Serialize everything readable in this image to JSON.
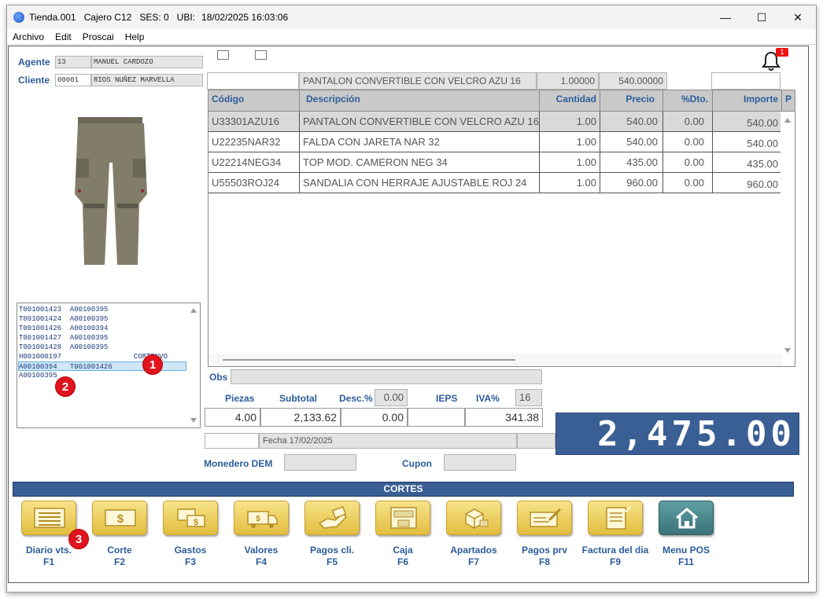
{
  "window": {
    "title_store": "Tienda.001",
    "title_cashier": "Cajero C12",
    "title_ses": "SES: 0",
    "title_ubi": "UBI:",
    "title_datetime": "18/02/2025 16:03:06",
    "minimize": "—",
    "maximize": "☐",
    "close": "✕"
  },
  "menu": [
    "Archivo",
    "Edit",
    "Proscai",
    "Help"
  ],
  "customer": {
    "agent_label": "Agente",
    "agent_id": "13",
    "agent_name": "MANUEL CARDOZO",
    "client_label": "Cliente",
    "client_id": "00001",
    "client_name": "RIOS NUÑEZ MARVELLA"
  },
  "notifications": {
    "count": "1"
  },
  "product_entry": {
    "code": "",
    "description": "PANTALON CONVERTIBLE CON VELCRO AZU 16",
    "quantity": "1.00000",
    "price": "540.00000",
    "extra": ""
  },
  "grid": {
    "columns": [
      "Código",
      "Descripción",
      "Cantidad",
      "Precio",
      "%Dto.",
      "Importe",
      "P"
    ],
    "rows": [
      {
        "code": "U33301AZU16",
        "desc": "PANTALON CONVERTIBLE CON VELCRO AZU 16",
        "qty": "1.00",
        "price": "540.00",
        "dto": "0.00",
        "importe": "540.00"
      },
      {
        "code": "U22235NAR32",
        "desc": "FALDA CON JARETA NAR 32",
        "qty": "1.00",
        "price": "540.00",
        "dto": "0.00",
        "importe": "540.00"
      },
      {
        "code": "U22214NEG34",
        "desc": "TOP MOD. CAMERON NEG 34",
        "qty": "1.00",
        "price": "435.00",
        "dto": "0.00",
        "importe": "435.00"
      },
      {
        "code": "U55503ROJ24",
        "desc": "SANDALIA CON HERRAJE AJUSTABLE ROJ 24",
        "qty": "1.00",
        "price": "960.00",
        "dto": "0.00",
        "importe": "960.00"
      }
    ]
  },
  "ticket_list": {
    "items": [
      "T001001423  A00100395",
      "T001001424  A00100395",
      "T001001426  A00100394",
      "T001001427  A00100395",
      "T001001428  A00100395",
      "H001000197                 CORTENVO",
      "A00100394   T001001426",
      "A00100395"
    ],
    "selected_index": 6
  },
  "badges": [
    "1",
    "2",
    "3"
  ],
  "totals": {
    "obs_label": "Obs",
    "obs_value": "",
    "piezas_label": "Piezas",
    "subtotal_label": "Subtotal",
    "desc_label": "Desc.%",
    "desc_pct": "0.00",
    "ieps_label": "IEPS",
    "iva_label": "IVA%",
    "iva_pct": "16",
    "piezas": "4.00",
    "subtotal": "2,133.62",
    "descuento": "0.00",
    "ieps": "",
    "iva": "341.38",
    "fecha": "Fecha 17/02/2025",
    "monedero_label": "Monedero DEM",
    "cupon_label": "Cupon",
    "grand_total": "2,475.00"
  },
  "cortes": {
    "title": "CORTES",
    "buttons": [
      {
        "label": "Diario vts.",
        "key": "F1",
        "icon": "ledger-icon"
      },
      {
        "label": "Corte",
        "key": "F2",
        "icon": "cash-bill-icon"
      },
      {
        "label": "Gastos",
        "key": "F3",
        "icon": "money-transfer-icon"
      },
      {
        "label": "Valores",
        "key": "F4",
        "icon": "armored-truck-icon"
      },
      {
        "label": "Pagos cli.",
        "key": "F5",
        "icon": "hand-payment-icon"
      },
      {
        "label": "Caja",
        "key": "F6",
        "icon": "cash-register-icon"
      },
      {
        "label": "Apartados",
        "key": "F7",
        "icon": "box-tag-icon"
      },
      {
        "label": "Pagos prv",
        "key": "F8",
        "icon": "check-pen-icon"
      },
      {
        "label": "Factura del dia",
        "key": "F9",
        "icon": "invoice-icon"
      },
      {
        "label": "Menu POS",
        "key": "F11",
        "icon": "home-icon"
      }
    ]
  }
}
